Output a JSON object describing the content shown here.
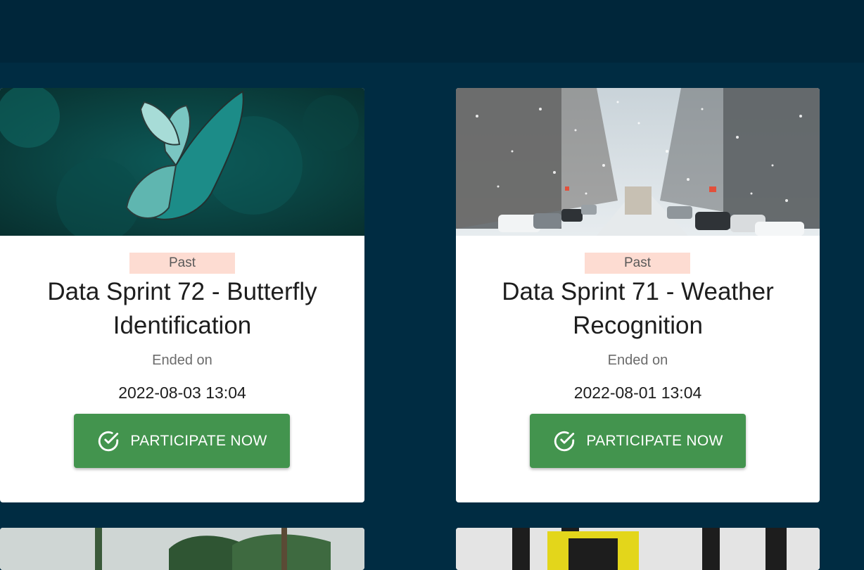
{
  "cards": [
    {
      "badge": "Past",
      "title": "Data Sprint 72 - Butterfly Identification",
      "ended_label": "Ended on",
      "date": "2022-08-03 13:04",
      "button_label": "PARTICIPATE NOW",
      "image": "butterfly-image"
    },
    {
      "badge": "Past",
      "title": "Data Sprint 71 - Weather Recognition",
      "ended_label": "Ended on",
      "date": "2022-08-01 13:04",
      "button_label": "PARTICIPATE NOW",
      "image": "snowy-street-image"
    }
  ],
  "colors": {
    "page_background": "#002c42",
    "header_background": "#00263a",
    "badge_background": "#fddcd2",
    "button_background": "#43944e"
  }
}
